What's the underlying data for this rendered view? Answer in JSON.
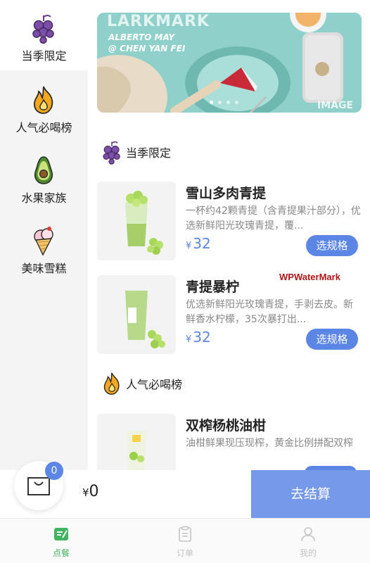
{
  "sidebar": {
    "items": [
      {
        "label": "当季限定",
        "icon": "grape-icon",
        "active": true
      },
      {
        "label": "人气必喝榜",
        "icon": "flame-icon",
        "active": false
      },
      {
        "label": "水果家族",
        "icon": "avocado-icon",
        "active": false
      },
      {
        "label": "美味雪糕",
        "icon": "ice-cream-icon",
        "active": false
      }
    ]
  },
  "banner": {
    "text_top": "LARKMARK",
    "text_author": "ALBERTO MAY",
    "text_credit": "@ CHEN YAN FEI",
    "text_corner": "IMAGE"
  },
  "sections": [
    {
      "title": "当季限定",
      "icon": "grape-icon",
      "products": [
        {
          "name": "雪山多肉青提",
          "desc": "一杯约42颗青提（含青提果汁部分），优选新鲜阳光玫瑰青提，覆...",
          "currency": "¥",
          "price": "32",
          "button": "选规格"
        },
        {
          "name": "青提暴柠",
          "desc": "优选新鲜阳光玫瑰青提，手剥去皮。新鲜香水柠檬，35次暴打出...",
          "currency": "¥",
          "price": "32",
          "button": "选规格"
        }
      ]
    },
    {
      "title": "人气必喝榜",
      "icon": "flame-icon",
      "products": [
        {
          "name": "双榨杨桃油柑",
          "desc": "油柑鲜果现压现榨，黄金比例拼配双榨",
          "currency": "¥",
          "price": "",
          "button": ""
        }
      ]
    }
  ],
  "watermark": "WPWaterMark",
  "cart": {
    "badge_count": "0",
    "currency": "¥",
    "total": "0",
    "checkout_label": "去结算"
  },
  "tabbar": {
    "items": [
      {
        "label": "点餐",
        "icon": "order-icon",
        "active": true
      },
      {
        "label": "订单",
        "icon": "clipboard-icon",
        "active": false
      },
      {
        "label": "我的",
        "icon": "user-icon",
        "active": false
      }
    ]
  },
  "colors": {
    "accent": "#5b86e6",
    "checkout": "#7799ea",
    "active_tab": "#42b35e",
    "sidebar_bg": "#f4f4f4"
  }
}
